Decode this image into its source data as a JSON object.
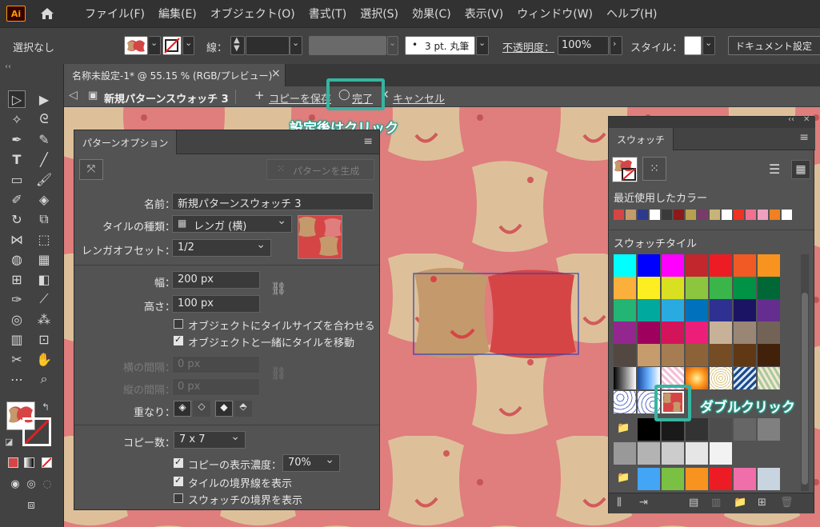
{
  "menubar": {
    "logo": "Ai",
    "items": [
      "ファイル(F)",
      "編集(E)",
      "オブジェクト(O)",
      "書式(T)",
      "選択(S)",
      "効果(C)",
      "表示(V)",
      "ウィンドウ(W)",
      "ヘルプ(H)"
    ]
  },
  "control": {
    "selection": "選択なし",
    "stroke_label": "線：",
    "brush": "3 pt. 丸筆",
    "opacity_label": "不透明度：",
    "opacity_value": "100%",
    "style_label": "スタイル：",
    "doc_settings": "ドキュメント設定"
  },
  "doc_tab": {
    "title": "名称未設定-1* @ 55.15 % (RGB/プレビュー)",
    "close": "×"
  },
  "pattern_bar": {
    "name": "新規パターンスウォッチ 3",
    "save_copy": "コピーを保存",
    "done": "完了",
    "cancel": "キャンセル"
  },
  "callouts": {
    "done": "設定後はクリック",
    "swatch": "ダブルクリック"
  },
  "pattern_options": {
    "tab": "パターンオプション",
    "generate": "パターンを生成",
    "name_label": "名前：",
    "name_value": "新規パターンスウォッチ 3",
    "tile_type_label": "タイルの種類：",
    "tile_type_value": "レンガ (横)",
    "brick_offset_label": "レンガオフセット：",
    "brick_offset_value": "1/2",
    "width_label": "幅：",
    "width_value": "200 px",
    "height_label": "高さ：",
    "height_value": "100 px",
    "size_to_art": "オブジェクトにタイルサイズを合わせる",
    "move_tile": "オブジェクトと一緒にタイルを移動",
    "h_spacing_label": "横の間隔：",
    "h_spacing_value": "0 px",
    "v_spacing_label": "縦の間隔：",
    "v_spacing_value": "0 px",
    "overlap_label": "重なり：",
    "copies_label": "コピー数：",
    "copies_value": "7 x 7",
    "dim_copies": "コピーの表示濃度：",
    "dim_value": "70%",
    "show_tile_edge": "タイルの境界線を表示",
    "show_swatch_bounds": "スウォッチの境界を表示",
    "size_to_art_checked": false,
    "move_tile_checked": true,
    "dim_copies_checked": true,
    "show_tile_edge_checked": true,
    "show_swatch_bounds_checked": false
  },
  "swatches": {
    "tab": "スウォッチ",
    "recent_label": "最近使用したカラー",
    "library_label": "スウォッチタイル",
    "recent_colors": [
      "#d64545",
      "#c49a6c",
      "#2d3a8c",
      "#ffffff",
      "#3a3a3a",
      "#8b1a1a",
      "#b8a050",
      "#7a3a6a",
      "#c8b478",
      "#ffffff",
      "#ee3322",
      "#f07090",
      "#f0a0c0",
      "#f08020",
      "#ffffff"
    ],
    "grid_rows": [
      [
        "#00ffff",
        "#0000ff",
        "#ff00ff",
        "#c1272d",
        "#ed1c24",
        "#f15a24",
        "#f7931e"
      ],
      [
        "#fbb03b",
        "#fcee21",
        "#d9e021",
        "#8cc63f",
        "#39b54a",
        "#009245",
        "#006837"
      ],
      [
        "#22b573",
        "#00a99d",
        "#29abe2",
        "#0071bc",
        "#2e3192",
        "#1b1464",
        "#662d91"
      ],
      [
        "#93278f",
        "#9e005d",
        "#d4145a",
        "#ed1e79",
        "#c7b299",
        "#998675",
        "#736357"
      ],
      [
        "#534741",
        "#c69c6d",
        "#a67c52",
        "#8c6239",
        "#754c24",
        "#603813",
        "#42210b"
      ]
    ],
    "gray_row_1": [
      "#000000",
      "#1a1a1a",
      "#333333",
      "#4d4d4d",
      "#666666",
      "#808080"
    ],
    "gray_row_2": [
      "#999999",
      "#b3b3b3",
      "#cccccc",
      "#e6e6e6",
      "#f2f2f2"
    ],
    "color_group": [
      "#42a5f5",
      "#7ac143",
      "#f7931e",
      "#ed1c24",
      "#f06eaa",
      "#c8d4e0"
    ]
  }
}
